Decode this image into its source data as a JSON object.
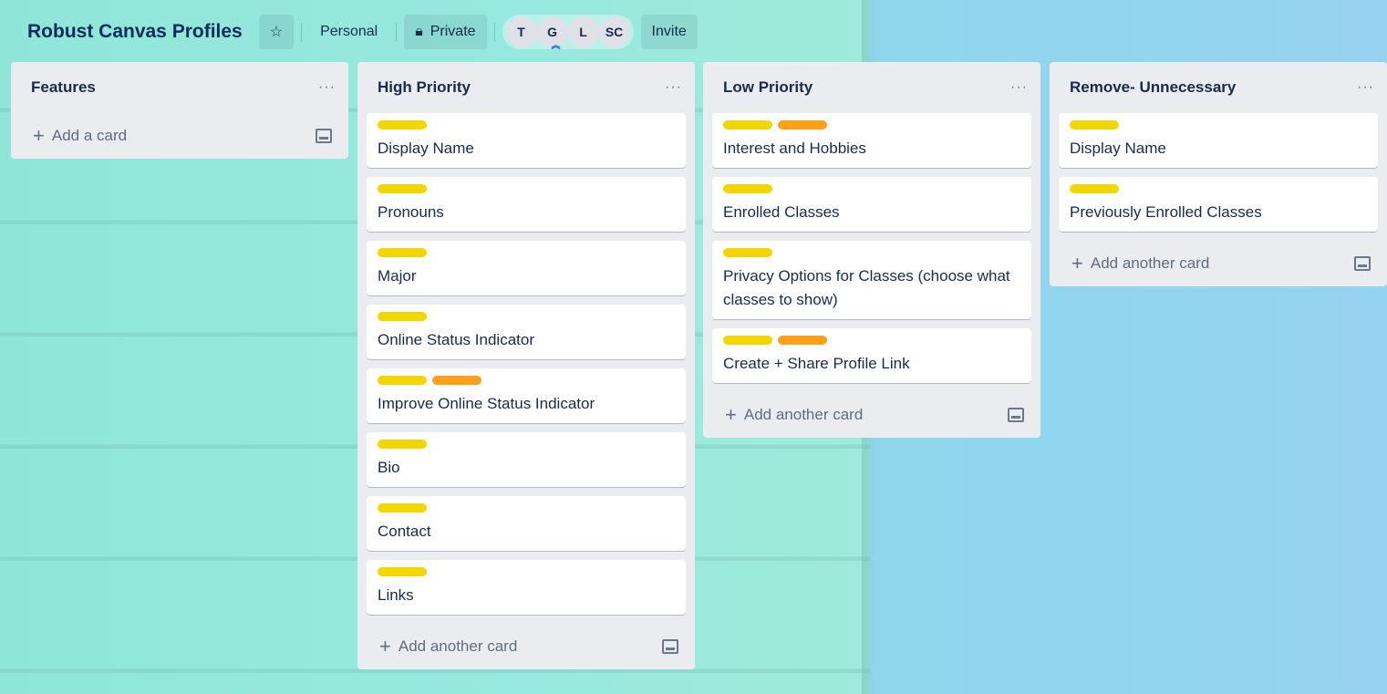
{
  "board": {
    "title": "Robust Canvas Profiles",
    "workspace_label": "Personal",
    "visibility_label": "Private",
    "invite_label": "Invite",
    "members": [
      "T",
      "G",
      "L",
      "SC"
    ]
  },
  "colors": {
    "yellow": "#f2d600",
    "orange": "#ff9f1a"
  },
  "lists": [
    {
      "title": "Features",
      "add_label": "Add a card",
      "cards": []
    },
    {
      "title": "High Priority",
      "add_label": "Add another card",
      "cards": [
        {
          "title": "Display Name",
          "labels": [
            "yellow"
          ]
        },
        {
          "title": "Pronouns",
          "labels": [
            "yellow"
          ]
        },
        {
          "title": "Major",
          "labels": [
            "yellow"
          ]
        },
        {
          "title": "Online Status Indicator",
          "labels": [
            "yellow"
          ]
        },
        {
          "title": "Improve Online Status Indicator",
          "labels": [
            "yellow",
            "orange"
          ]
        },
        {
          "title": "Bio",
          "labels": [
            "yellow"
          ]
        },
        {
          "title": "Contact",
          "labels": [
            "yellow"
          ]
        },
        {
          "title": "Links",
          "labels": [
            "yellow"
          ]
        }
      ]
    },
    {
      "title": "Low Priority",
      "add_label": "Add another card",
      "cards": [
        {
          "title": "Interest and Hobbies",
          "labels": [
            "yellow",
            "orange"
          ]
        },
        {
          "title": "Enrolled Classes",
          "labels": [
            "yellow"
          ]
        },
        {
          "title": "Privacy Options for Classes (choose what classes to show)",
          "labels": [
            "yellow"
          ]
        },
        {
          "title": "Create + Share Profile Link",
          "labels": [
            "yellow",
            "orange"
          ]
        }
      ]
    },
    {
      "title": "Remove- Unnecessary",
      "add_label": "Add another card",
      "cards": [
        {
          "title": "Display Name",
          "labels": [
            "yellow"
          ]
        },
        {
          "title": "Previously Enrolled Classes",
          "labels": [
            "yellow"
          ]
        }
      ]
    }
  ]
}
